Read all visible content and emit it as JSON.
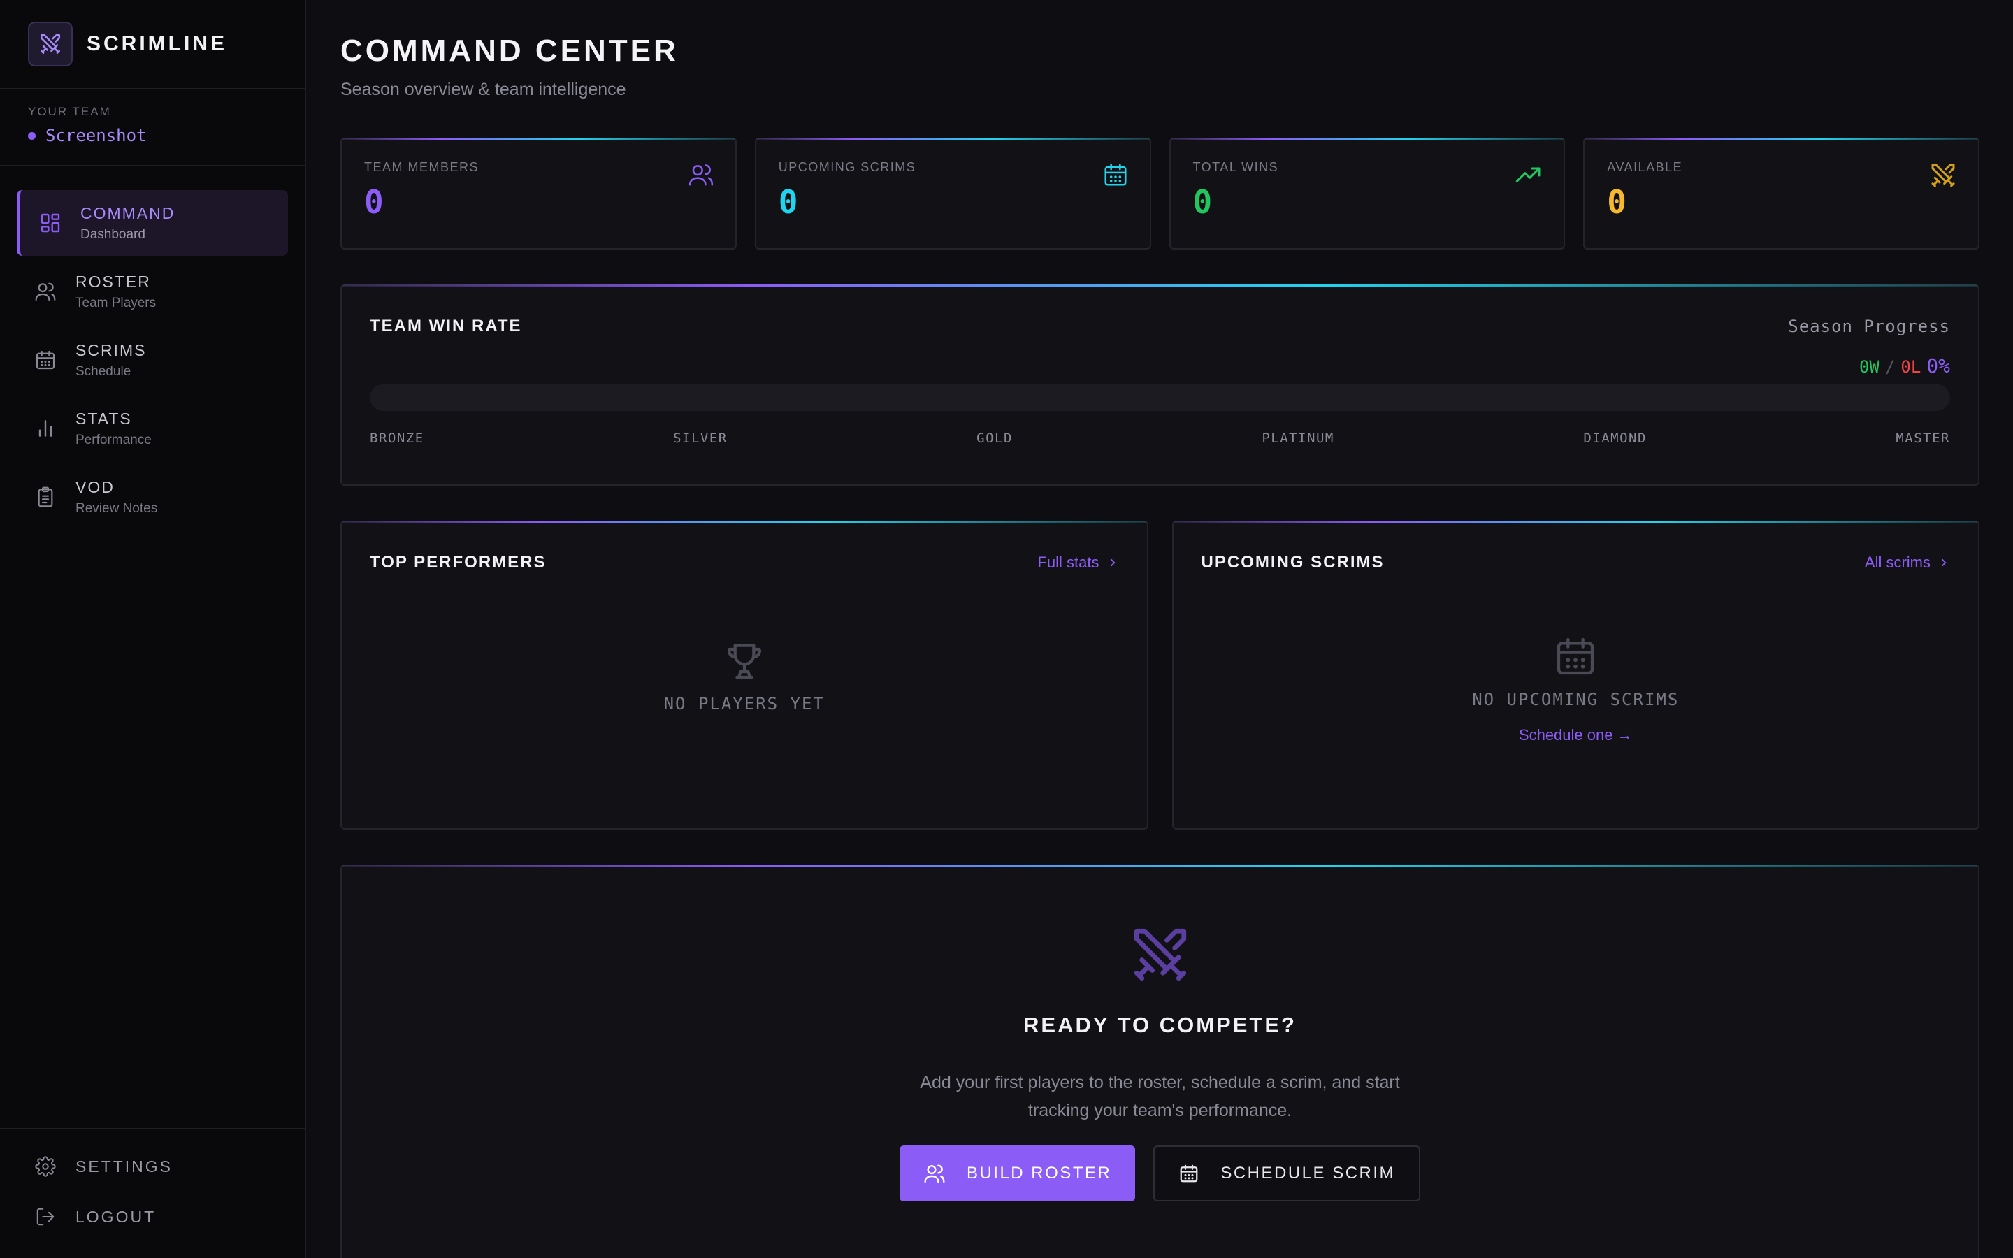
{
  "brand": {
    "name": "SCRIMLINE",
    "icon": "crossed-swords-icon"
  },
  "team": {
    "label": "YOUR TEAM",
    "name": "Screenshot"
  },
  "nav": [
    {
      "title": "COMMAND",
      "sub": "Dashboard",
      "icon": "dashboard-icon",
      "active": true
    },
    {
      "title": "ROSTER",
      "sub": "Team Players",
      "icon": "users-icon"
    },
    {
      "title": "SCRIMS",
      "sub": "Schedule",
      "icon": "calendar-icon"
    },
    {
      "title": "STATS",
      "sub": "Performance",
      "icon": "bar-chart-icon"
    },
    {
      "title": "VOD",
      "sub": "Review Notes",
      "icon": "clipboard-icon"
    }
  ],
  "bottom_links": {
    "settings": "SETTINGS",
    "logout": "LOGOUT"
  },
  "header": {
    "title": "COMMAND CENTER",
    "subtitle": "Season overview & team intelligence"
  },
  "stats": [
    {
      "label": "TEAM MEMBERS",
      "value": "0",
      "color": "#8b5cf6",
      "icon": "users-icon"
    },
    {
      "label": "UPCOMING SCRIMS",
      "value": "0",
      "color": "#22d3ee",
      "icon": "calendar-icon"
    },
    {
      "label": "TOTAL WINS",
      "value": "0",
      "color": "#22c55e",
      "icon": "trending-up-icon"
    },
    {
      "label": "AVAILABLE",
      "value": "0",
      "color": "#f5b82e",
      "icon": "crossed-swords-icon"
    }
  ],
  "win_rate": {
    "title": "TEAM WIN RATE",
    "season_label": "Season Progress",
    "wins": "0W",
    "losses": "0L",
    "separator": "/",
    "percent": "0%",
    "progress": 0,
    "ranks": [
      "BRONZE",
      "SILVER",
      "GOLD",
      "PLATINUM",
      "DIAMOND",
      "MASTER"
    ]
  },
  "top_performers": {
    "title": "TOP PERFORMERS",
    "link": "Full stats",
    "empty": "NO PLAYERS YET"
  },
  "upcoming_scrims": {
    "title": "UPCOMING SCRIMS",
    "link": "All scrims",
    "empty": "NO UPCOMING SCRIMS",
    "action": "Schedule one →"
  },
  "cta": {
    "title": "READY TO COMPETE?",
    "description": "Add your first players to the roster, schedule a scrim, and start tracking your team's performance.",
    "primary": "BUILD ROSTER",
    "secondary": "SCHEDULE SCRIM"
  },
  "colors": {
    "accent": "#8b5cf6",
    "cyan": "#22d3ee",
    "green": "#22c55e",
    "amber": "#f5b82e",
    "red": "#ef4444"
  }
}
